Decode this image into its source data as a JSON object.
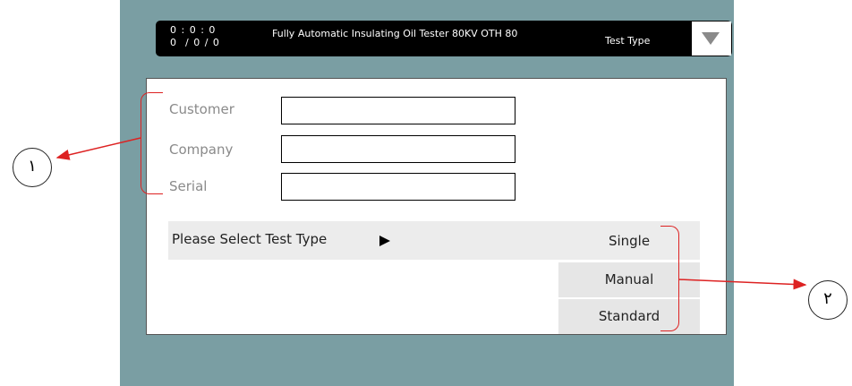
{
  "header": {
    "time": "0 : 0 : 0",
    "date": "0  / 0 / 0",
    "title": "Fully Automatic Insulating Oil Tester 80KV OTH 80",
    "screen_label": "Test Type",
    "dropdown_icon": "triangle-down-icon"
  },
  "form": {
    "fields": [
      {
        "label": "Customer",
        "value": ""
      },
      {
        "label": "Company",
        "value": ""
      },
      {
        "label": "Serial",
        "value": ""
      }
    ],
    "select_prompt": "Please Select Test Type",
    "options": [
      "Single",
      "Manual",
      "Standard"
    ]
  },
  "callouts": {
    "one": "١",
    "two": "٢"
  },
  "colors": {
    "panel_bg": "#7a9ea3",
    "titlebar_bg": "#000000",
    "annotation": "#dd2222"
  }
}
